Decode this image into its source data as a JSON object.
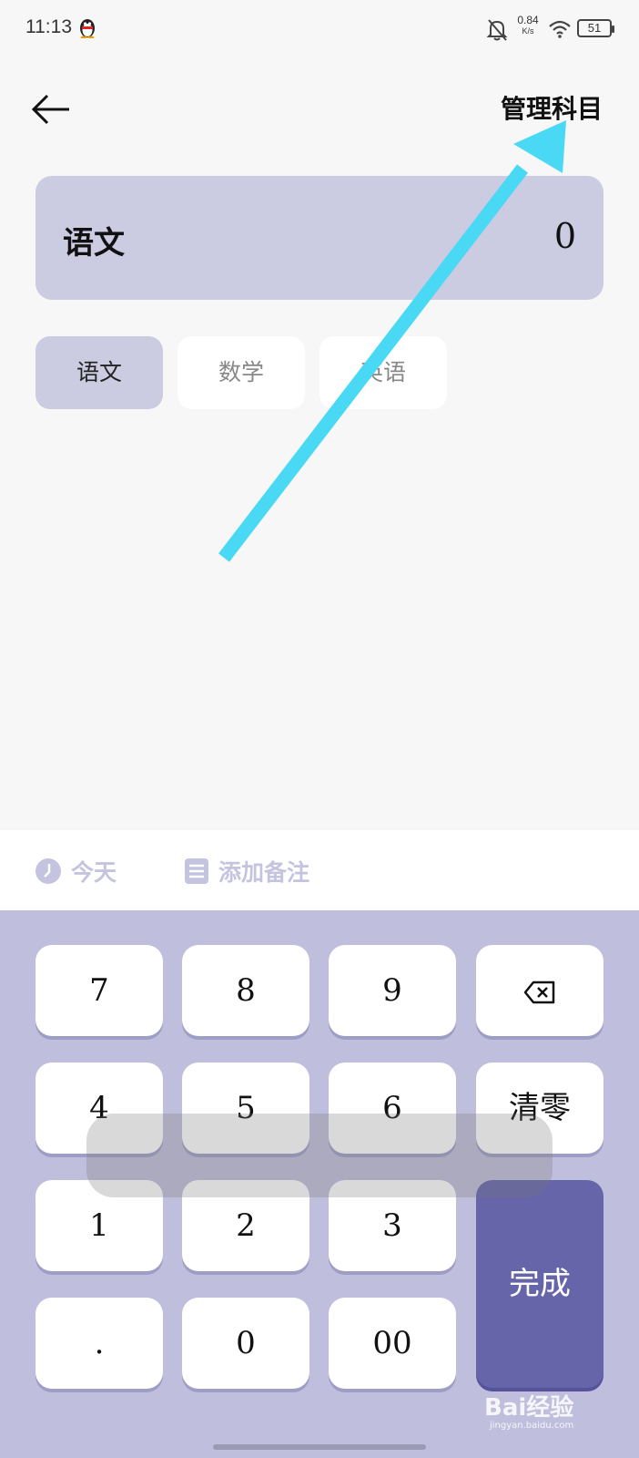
{
  "status_bar": {
    "time": "11:13",
    "net_speed_value": "0.84",
    "net_speed_unit": "K/s",
    "battery": "51",
    "icons": [
      "qq-penguin-icon",
      "bell-off-icon",
      "wifi-icon",
      "battery-icon"
    ]
  },
  "header": {
    "back_icon": "arrow-left-icon",
    "manage_label": "管理科目"
  },
  "subject_card": {
    "subject": "语文",
    "amount": "0"
  },
  "subject_chips": [
    {
      "label": "语文",
      "selected": true
    },
    {
      "label": "数学",
      "selected": false
    },
    {
      "label": "英语",
      "selected": false
    }
  ],
  "options": {
    "today_label": "今天",
    "note_label": "添加备注"
  },
  "keypad": {
    "keys": [
      "7",
      "8",
      "9",
      "4",
      "5",
      "6",
      "1",
      "2",
      "3",
      ".",
      "0",
      "00"
    ],
    "backspace_icon": "backspace-icon",
    "clear_label": "清零",
    "done_label": "完成"
  },
  "watermark": {
    "text": "Bai经验",
    "url_text": "jingyan.baidu.com"
  },
  "colors": {
    "accent_light": "#cbcbe1",
    "keypad_bg": "#bfbedc",
    "done_button": "#6665aa",
    "annotation_arrow": "#49d9f5"
  }
}
